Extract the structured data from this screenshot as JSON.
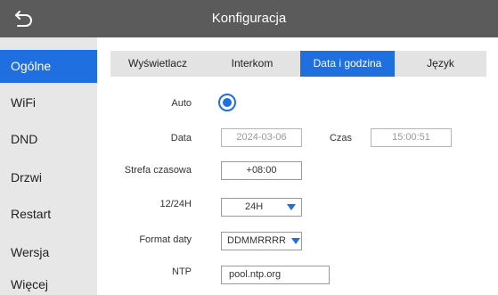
{
  "header": {
    "title": "Konfiguracja"
  },
  "sidebar": {
    "items": [
      {
        "label": "Ogólne",
        "active": true
      },
      {
        "label": "WiFi"
      },
      {
        "label": "DND"
      },
      {
        "label": "Drzwi"
      },
      {
        "label": "Restart"
      },
      {
        "label": "Wersja"
      },
      {
        "label": "Więcej"
      }
    ]
  },
  "tabs": [
    {
      "label": "Wyświetlacz"
    },
    {
      "label": "Interkom"
    },
    {
      "label": "Data i godzina",
      "active": true
    },
    {
      "label": "Język"
    }
  ],
  "form": {
    "auto_label": "Auto",
    "auto_checked": true,
    "date_label": "Data",
    "date_value": "2024-03-06",
    "time_label": "Czas",
    "time_value": "15:00:51",
    "timezone_label": "Strefa czasowa",
    "timezone_value": "+08:00",
    "hour_format_label": "12/24H",
    "hour_format_value": "24H",
    "date_format_label": "Format daty",
    "date_format_value": "DDMMRRRR",
    "ntp_label": "NTP",
    "ntp_value": "pool.ntp.org"
  },
  "colors": {
    "accent": "#1f6fe0",
    "topbar": "#5b5b5b",
    "sidebar": "#e7e7e7",
    "tabs": "#e3e3e3"
  },
  "icons": {
    "back": "back-arrow-icon",
    "dropdown": "caret-down-icon"
  }
}
